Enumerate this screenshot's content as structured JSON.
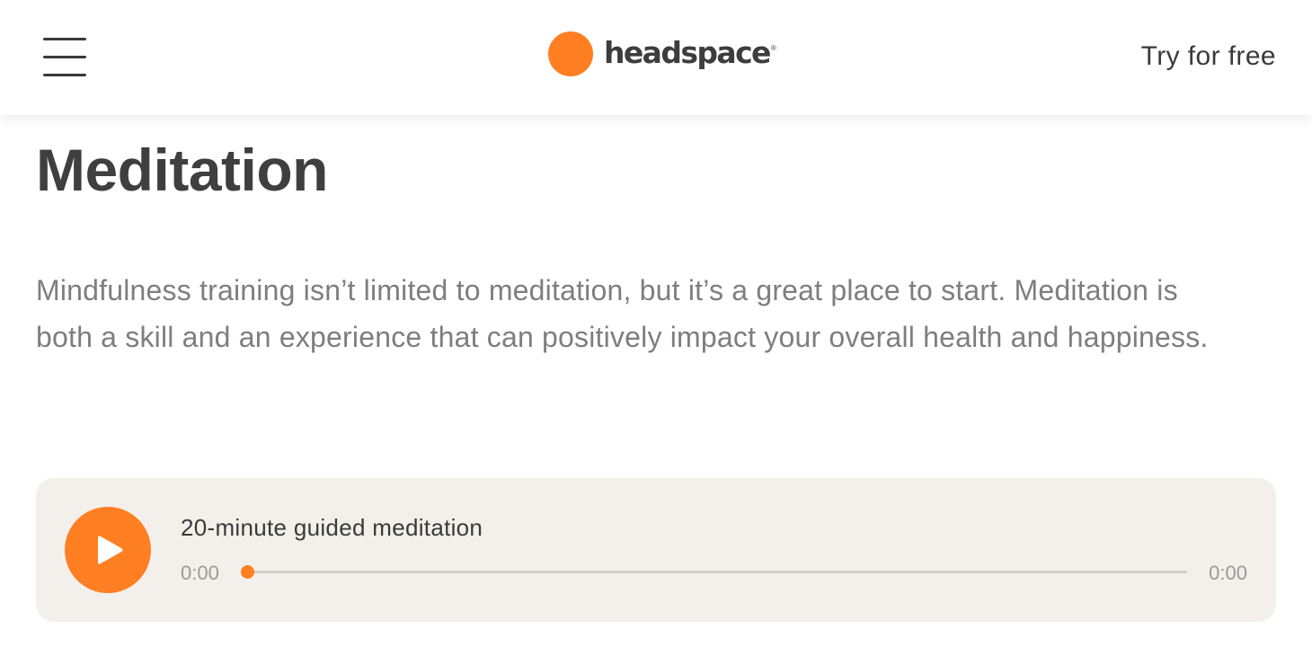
{
  "colors": {
    "brand": "#ff7f22"
  },
  "header": {
    "menu_icon": "hamburger-menu-icon",
    "logo_text": "headspace",
    "logo_mark": "®",
    "cta_label": "Try for free"
  },
  "main": {
    "title": "Meditation",
    "intro": "Mindfulness training isn’t limited to meditation, but it’s a great place to start. Meditation is both a skill and an experience that can positively impact your overall health and happiness."
  },
  "player": {
    "play_icon": "play-icon",
    "track_title": "20-minute guided meditation",
    "current_time": "0:00",
    "total_time": "0:00",
    "progress": 0
  }
}
